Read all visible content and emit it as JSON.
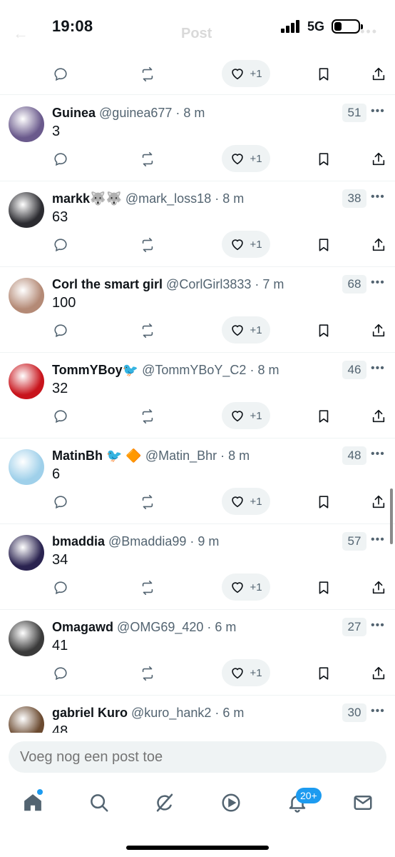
{
  "status_bar": {
    "time": "19:08",
    "network": "5G",
    "page_title": "Post"
  },
  "posts": [
    {
      "name": "Guinea",
      "handle": "@guinea677",
      "time": "8 m",
      "text": "3",
      "score": "51",
      "like_count": "+1",
      "avatar_color": "#6a5a8c"
    },
    {
      "name": "markk🐺🐺",
      "handle": "@mark_loss18",
      "time": "8 m",
      "text": "63",
      "score": "38",
      "like_count": "+1",
      "avatar_color": "#2b2b30"
    },
    {
      "name": "Corl the smart girl",
      "handle": "@CorlGirl3833",
      "time": "7 m",
      "text": "100",
      "score": "68",
      "like_count": "+1",
      "avatar_color": "#b48a76"
    },
    {
      "name": "TommYBoy🐦",
      "handle": "@TommYBoY_C2",
      "time": "8 m",
      "text": "32",
      "score": "46",
      "like_count": "+1",
      "avatar_color": "#c8141c"
    },
    {
      "name": "MatinBh 🐦 🔶",
      "handle": "@Matin_Bhr",
      "time": "8 m",
      "text": "6",
      "score": "48",
      "like_count": "+1",
      "avatar_color": "#9fd0ea"
    },
    {
      "name": "bmaddia",
      "handle": "@Bmaddia99",
      "time": "9 m",
      "text": "34",
      "score": "57",
      "like_count": "+1",
      "avatar_color": "#2a2350"
    },
    {
      "name": "Omagawd",
      "handle": "@OMG69_420",
      "time": "6 m",
      "text": "41",
      "score": "27",
      "like_count": "+1",
      "avatar_color": "#3a3a3a"
    },
    {
      "name": "gabriel Kuro",
      "handle": "@kuro_hank2",
      "time": "6 m",
      "text": "48",
      "score": "30",
      "like_count": "+1",
      "avatar_color": "#6b4a30"
    }
  ],
  "top_like_count": "+1",
  "reply": {
    "placeholder": "Voeg nog een post toe"
  },
  "tabs": {
    "notifications_badge": "20+"
  },
  "icons": {
    "reply": "reply-icon",
    "retweet": "repost-icon",
    "like": "heart-icon",
    "bookmark": "bookmark-icon",
    "share": "share-icon",
    "home": "home-icon",
    "search": "search-icon",
    "grok": "grok-icon",
    "video": "video-icon",
    "notifications": "bell-icon",
    "messages": "mail-icon"
  },
  "colors": {
    "accent": "#1d9bf0",
    "text_primary": "#0f1419",
    "text_secondary": "#536471",
    "chip_bg": "#eff3f4"
  }
}
